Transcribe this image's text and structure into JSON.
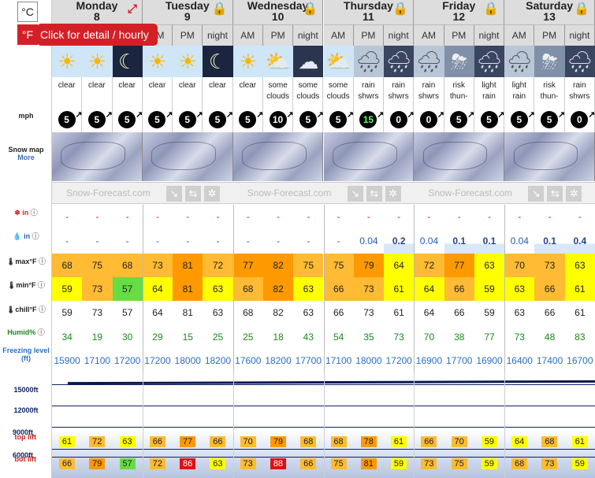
{
  "units": {
    "celsius": "°C",
    "fahrenheit": "°F",
    "tooltip": "Click for detail / hourly"
  },
  "labels": {
    "mph": "mph",
    "snow_map": "Snow map",
    "more": "More",
    "snow_in": "in",
    "rain_in": "in",
    "max": "max°F",
    "min": "min°F",
    "chill": "chill°F",
    "humid": "Humid%",
    "freezing": "Freezing level (ft)",
    "l15000": "15000ft",
    "l12000": "12000ft",
    "l9000": "9000ft",
    "l6000": "6000ft",
    "top_lift": "top lift",
    "bot_lift": "bot lift"
  },
  "days": [
    {
      "name": "Monday",
      "num": "8",
      "tod": [
        "AM",
        "PM",
        "night"
      ]
    },
    {
      "name": "Tuesday",
      "num": "9",
      "tod": [
        "AM",
        "PM",
        "night"
      ]
    },
    {
      "name": "Wednesday",
      "num": "10",
      "tod": [
        "AM",
        "PM",
        "night"
      ]
    },
    {
      "name": "Thursday",
      "num": "11",
      "tod": [
        "AM",
        "PM",
        "night"
      ]
    },
    {
      "name": "Friday",
      "num": "12",
      "tod": [
        "AM",
        "PM",
        "night"
      ]
    },
    {
      "name": "Saturday",
      "num": "13",
      "tod": [
        "AM",
        "PM",
        "night"
      ]
    }
  ],
  "weather": [
    "clear",
    "clear",
    "clear",
    "clear",
    "clear",
    "clear",
    "clear",
    "some clouds",
    "some clouds",
    "some clouds",
    "rain shwrs",
    "rain shwrs",
    "rain shwrs",
    "risk thun-",
    "light rain",
    "light rain",
    "risk thun-",
    "rain shwrs"
  ],
  "icons": [
    "sun",
    "sun",
    "moon",
    "sun",
    "sun",
    "moon",
    "sun",
    "sun-cloud",
    "cloud-night",
    "sun-cloud",
    "rain-cloud",
    "rain-night",
    "rain-cloud",
    "thunder",
    "rain-night",
    "rain-cloud",
    "thunder",
    "rain-night"
  ],
  "wind": [
    "5",
    "5",
    "5",
    "5",
    "5",
    "5",
    "5",
    "10",
    "5",
    "5",
    "15",
    "0",
    "0",
    "5",
    "5",
    "5",
    "5",
    "0"
  ],
  "branding": "Snow-Forecast.com",
  "snow": [
    "-",
    "-",
    "-",
    "-",
    "-",
    "-",
    "-",
    "-",
    "-",
    "-",
    "-",
    "-",
    "-",
    "-",
    "-",
    "-",
    "-",
    "-"
  ],
  "rain": [
    "-",
    "-",
    "-",
    "-",
    "-",
    "-",
    "-",
    "-",
    "-",
    "-",
    "0.04",
    "0.2",
    "0.04",
    "0.1",
    "0.1",
    "0.04",
    "0.1",
    "0.4"
  ],
  "max": [
    "68",
    "75",
    "68",
    "73",
    "81",
    "72",
    "77",
    "82",
    "75",
    "75",
    "79",
    "64",
    "72",
    "77",
    "63",
    "70",
    "73",
    "63"
  ],
  "min": [
    "59",
    "73",
    "57",
    "64",
    "81",
    "63",
    "68",
    "82",
    "63",
    "66",
    "73",
    "61",
    "64",
    "66",
    "59",
    "63",
    "66",
    "61"
  ],
  "chill": [
    "59",
    "73",
    "57",
    "64",
    "81",
    "63",
    "68",
    "82",
    "63",
    "66",
    "73",
    "61",
    "64",
    "66",
    "59",
    "63",
    "66",
    "61"
  ],
  "humid": [
    "34",
    "19",
    "30",
    "29",
    "15",
    "25",
    "25",
    "18",
    "43",
    "54",
    "35",
    "73",
    "70",
    "38",
    "77",
    "73",
    "48",
    "83"
  ],
  "freezing": [
    "15900",
    "17100",
    "17200",
    "17200",
    "18000",
    "18200",
    "17600",
    "18200",
    "17700",
    "17100",
    "18000",
    "17200",
    "16900",
    "17700",
    "16900",
    "16400",
    "17400",
    "16700"
  ],
  "top_lift": [
    "61",
    "72",
    "63",
    "66",
    "77",
    "66",
    "70",
    "79",
    "68",
    "68",
    "78",
    "61",
    "66",
    "70",
    "59",
    "64",
    "68",
    "61"
  ],
  "bot_lift": [
    "66",
    "79",
    "57",
    "72",
    "86",
    "63",
    "73",
    "88",
    "66",
    "75",
    "81",
    "59",
    "73",
    "75",
    "59",
    "68",
    "73",
    "59"
  ],
  "colors": {
    "yellow": "#ffff00",
    "orange": "#ff9900",
    "lightorange": "#ffbb33",
    "green": "#66dd44",
    "red": "#dd1111",
    "tip": "#d32027"
  }
}
